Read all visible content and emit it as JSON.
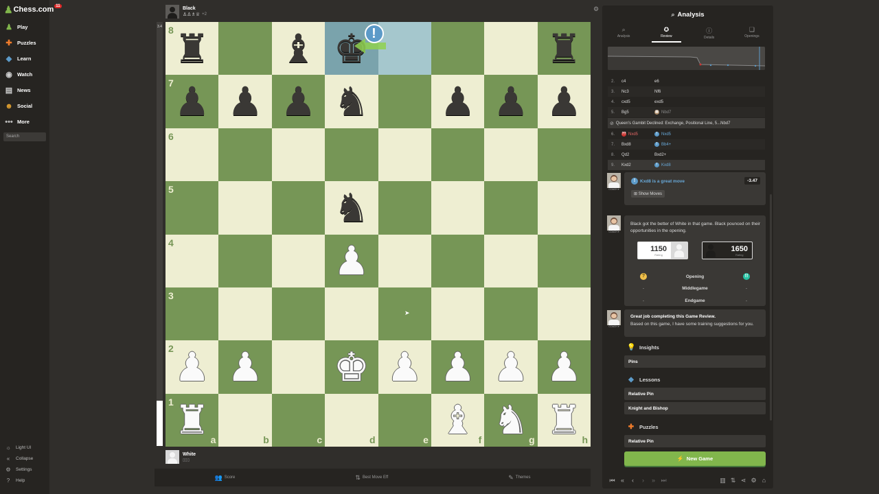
{
  "brand": {
    "name": "Chess.com",
    "badge": "11"
  },
  "sidebar": {
    "items": [
      {
        "label": "Play",
        "icon": "play-icon",
        "glyph": "♟",
        "color": "#81b64c"
      },
      {
        "label": "Puzzles",
        "icon": "puzzle-icon",
        "glyph": "✚",
        "color": "#f07c2b"
      },
      {
        "label": "Learn",
        "icon": "learn-icon",
        "glyph": "◆",
        "color": "#5c9ac8"
      },
      {
        "label": "Watch",
        "icon": "watch-icon",
        "glyph": "◉",
        "color": "#cccccc"
      },
      {
        "label": "News",
        "icon": "news-icon",
        "glyph": "▤",
        "color": "#cccccc"
      },
      {
        "label": "Social",
        "icon": "social-icon",
        "glyph": "☻",
        "color": "#e0a030"
      },
      {
        "label": "More",
        "icon": "more-icon",
        "glyph": "•••",
        "color": "#bbbbbb"
      }
    ],
    "search_placeholder": "Search",
    "bottom": [
      {
        "label": "Light UI",
        "icon": "sun-icon",
        "glyph": "☼"
      },
      {
        "label": "Collapse",
        "icon": "collapse-icon",
        "glyph": "«"
      },
      {
        "label": "Settings",
        "icon": "gear-icon",
        "glyph": "⚙"
      },
      {
        "label": "Help",
        "icon": "help-icon",
        "glyph": "?"
      }
    ]
  },
  "board": {
    "eval": "3.4",
    "top_player": {
      "name": "Black",
      "captures": "♙♙♗♕",
      "advantage": "+2"
    },
    "bottom_player": {
      "name": "White",
      "captures": ""
    },
    "files": [
      "a",
      "b",
      "c",
      "d",
      "e",
      "f",
      "g",
      "h"
    ],
    "ranks": [
      "8",
      "7",
      "6",
      "5",
      "4",
      "3",
      "2",
      "1"
    ],
    "position": [
      [
        "r",
        "",
        "b",
        "k",
        "",
        "",
        "",
        "r"
      ],
      [
        "p",
        "p",
        "p",
        "n",
        "",
        "p",
        "p",
        "p"
      ],
      [
        "",
        "",
        "",
        "",
        "",
        "",
        "",
        ""
      ],
      [
        "",
        "",
        "",
        "n",
        "",
        "",
        "",
        ""
      ],
      [
        "",
        "",
        "",
        "P",
        "",
        "",
        "",
        ""
      ],
      [
        "",
        "",
        "",
        "",
        "",
        "",
        "",
        ""
      ],
      [
        "P",
        "P",
        "",
        "K",
        "P",
        "P",
        "P",
        "P"
      ],
      [
        "R",
        "",
        "",
        "",
        "",
        "B",
        "N",
        "R"
      ]
    ],
    "last_move_from": "e8",
    "last_move_to": "d8",
    "move_badge": "!"
  },
  "bottom_bar": [
    {
      "label": "Score",
      "icon": "users-icon",
      "glyph": "👥"
    },
    {
      "label": "Best Move Eff",
      "icon": "arrows-icon",
      "glyph": "⇅"
    },
    {
      "label": "Themes",
      "icon": "theme-icon",
      "glyph": "✎"
    }
  ],
  "panel": {
    "title": "Analysis",
    "tabs": [
      {
        "label": "Analysis",
        "icon": "magnifier-icon",
        "glyph": "⌕",
        "active": false
      },
      {
        "label": "Review",
        "icon": "star-icon",
        "glyph": "✪",
        "active": true
      },
      {
        "label": "Details",
        "icon": "info-icon",
        "glyph": "ⓘ",
        "active": false
      },
      {
        "label": "Openings",
        "icon": "book-icon",
        "glyph": "❏",
        "active": false
      }
    ],
    "moves": [
      {
        "num": "2.",
        "white": "c4",
        "black": "e6",
        "wmark": "",
        "bmark": ""
      },
      {
        "num": "3.",
        "white": "Nc3",
        "black": "Nf6",
        "wmark": "",
        "bmark": ""
      },
      {
        "num": "4.",
        "white": "cxd5",
        "black": "exd5",
        "wmark": "",
        "bmark": ""
      },
      {
        "num": "5.",
        "white": "Bg5",
        "black": "Nbd7",
        "wmark": "",
        "bmark": "book"
      }
    ],
    "opening_name": "Queen's Gambit Declined: Exchange, Positional Line, 5...Nbd7",
    "moves2": [
      {
        "num": "6.",
        "white": "Nxd5",
        "black": "Nxd5",
        "wmark": "blunder",
        "bmark": "great"
      },
      {
        "num": "7.",
        "white": "Bxd8",
        "black": "Bb4+",
        "wmark": "",
        "bmark": "great"
      },
      {
        "num": "8.",
        "white": "Qd2",
        "black": "Bxd2+",
        "wmark": "",
        "bmark": ""
      },
      {
        "num": "9.",
        "white": "Kxd2",
        "black": "Kxd8",
        "wmark": "",
        "bmark": "great"
      }
    ],
    "coach_label": "COACH ▾",
    "great_move": "Kxd8 is a great move",
    "eval_chip": "-3.47",
    "show_moves": "Show Moves",
    "summary": "Black got the better of White in that game. Black pounced on their opportunities in the opening.",
    "white_rating": "1150",
    "black_rating": "1650",
    "rating_label": "Rating",
    "phases": [
      {
        "name": "Opening",
        "left": "",
        "right": ""
      },
      {
        "name": "Middlegame",
        "left": "-",
        "right": "-"
      },
      {
        "name": "Endgame",
        "left": "-",
        "right": "-"
      }
    ],
    "complete_title": "Great job completing this Game Review.",
    "complete_body": "Based on this game, I have some training suggestions for you.",
    "insights_title": "Insights",
    "insights": [
      "Pins"
    ],
    "lessons_title": "Lessons",
    "lessons": [
      "Relative Pin",
      "Knight and Bishop"
    ],
    "puzzles_title": "Puzzles",
    "puzzles": [
      "Relative Pin"
    ],
    "new_game": "New Game"
  },
  "colors": {
    "light_square": "#eeeed2",
    "dark_square": "#769656",
    "accent_green": "#81b64c",
    "great_blue": "#5c9ac8"
  }
}
